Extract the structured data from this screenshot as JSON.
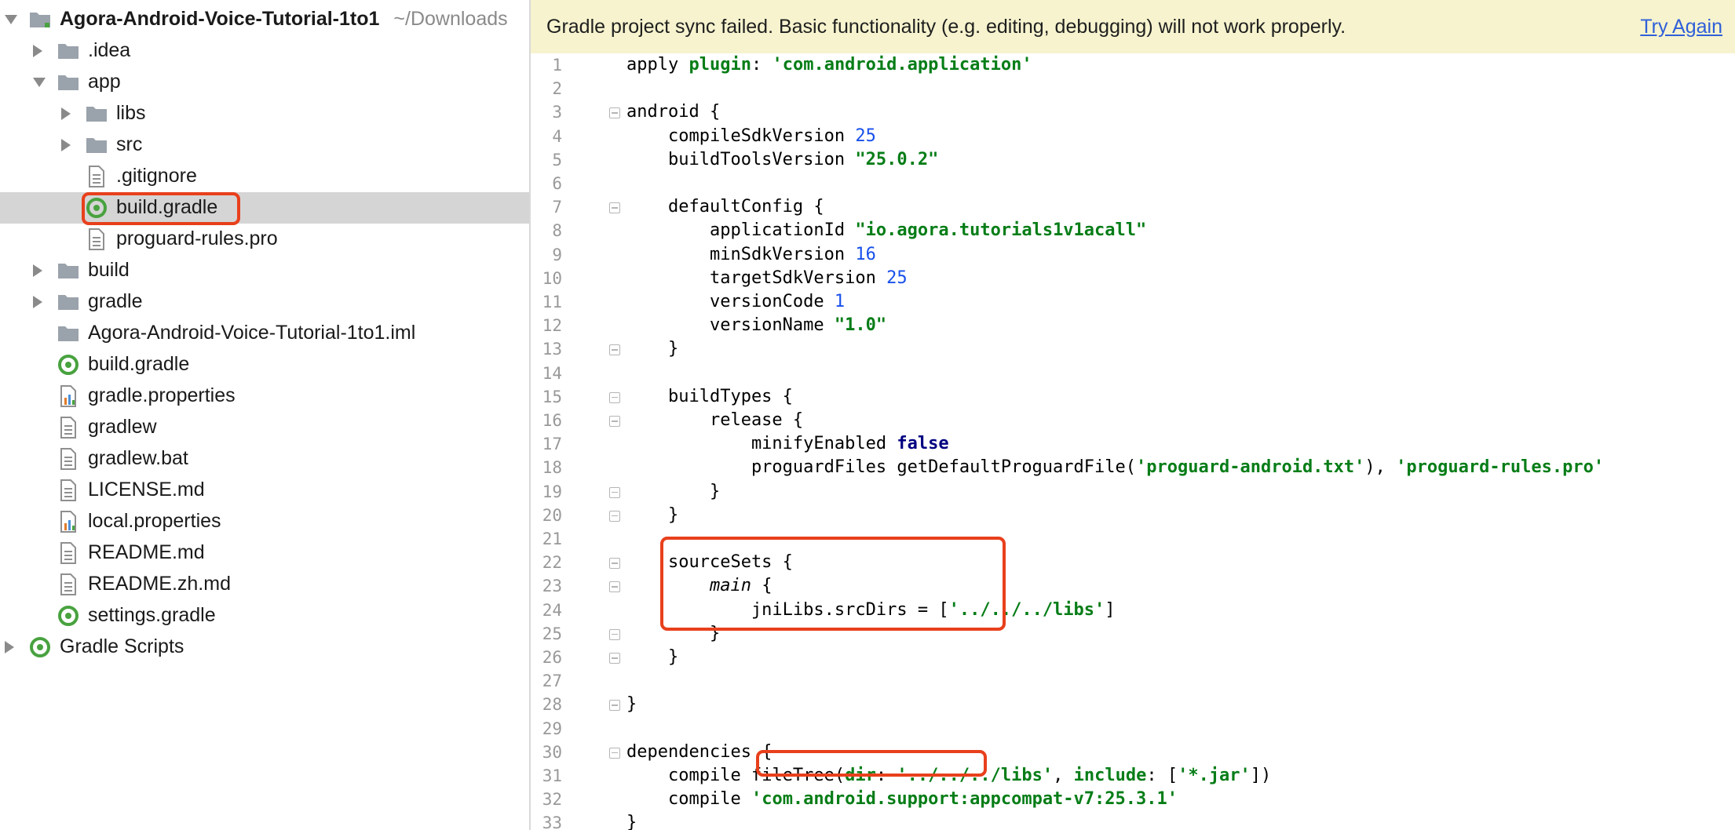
{
  "project_tree": {
    "root": {
      "name": "Agora-Android-Voice-Tutorial-1to1",
      "path": "~/Downloads"
    },
    "items": [
      {
        "label": ".idea"
      },
      {
        "label": "app"
      },
      {
        "label": "libs"
      },
      {
        "label": "src"
      },
      {
        "label": ".gitignore"
      },
      {
        "label": "build.gradle"
      },
      {
        "label": "proguard-rules.pro"
      },
      {
        "label": "build"
      },
      {
        "label": "gradle"
      },
      {
        "label": "Agora-Android-Voice-Tutorial-1to1.iml"
      },
      {
        "label": "build.gradle"
      },
      {
        "label": "gradle.properties"
      },
      {
        "label": "gradlew"
      },
      {
        "label": "gradlew.bat"
      },
      {
        "label": "LICENSE.md"
      },
      {
        "label": "local.properties"
      },
      {
        "label": "README.md"
      },
      {
        "label": "README.zh.md"
      },
      {
        "label": "settings.gradle"
      }
    ],
    "scripts_group": {
      "label": "Gradle Scripts"
    }
  },
  "banner": {
    "message": "Gradle project sync failed. Basic functionality (e.g. editing, debugging) will not work properly.",
    "action": "Try Again"
  },
  "editor": {
    "line_numbers": [
      "1",
      "2",
      "3",
      "4",
      "5",
      "6",
      "7",
      "8",
      "9",
      "10",
      "11",
      "12",
      "13",
      "14",
      "15",
      "16",
      "17",
      "18",
      "19",
      "20",
      "21",
      "22",
      "23",
      "24",
      "25",
      "26",
      "27",
      "28",
      "29",
      "30",
      "31",
      "32",
      "33"
    ],
    "lines": [
      [
        [
          "apply ",
          ""
        ],
        [
          "plugin",
          ""
        ],
        [
          ": ",
          ""
        ],
        [
          "'com.android.application'",
          "str"
        ]
      ],
      [],
      [
        [
          "android {",
          ""
        ]
      ],
      [
        [
          "    compileSdkVersion ",
          ""
        ],
        [
          "25",
          "num"
        ]
      ],
      [
        [
          "    buildToolsVersion ",
          ""
        ],
        [
          "\"25.0.2\"",
          "str"
        ]
      ],
      [],
      [
        [
          "    defaultConfig {",
          ""
        ]
      ],
      [
        [
          "        applicationId ",
          ""
        ],
        [
          "\"io.agora.tutorials1v1acall\"",
          "str"
        ]
      ],
      [
        [
          "        minSdkVersion ",
          ""
        ],
        [
          "16",
          "num"
        ]
      ],
      [
        [
          "        targetSdkVersion ",
          ""
        ],
        [
          "25",
          "num"
        ]
      ],
      [
        [
          "        versionCode ",
          ""
        ],
        [
          "1",
          "num"
        ]
      ],
      [
        [
          "        versionName ",
          ""
        ],
        [
          "\"1.0\"",
          "str"
        ]
      ],
      [
        [
          "    }",
          ""
        ]
      ],
      [],
      [
        [
          "    buildTypes {",
          ""
        ]
      ],
      [
        [
          "        release {",
          ""
        ]
      ],
      [
        [
          "            minifyEnabled ",
          ""
        ],
        [
          "false",
          "kw"
        ]
      ],
      [
        [
          "            proguardFiles getDefaultProguardFile(",
          ""
        ],
        [
          "'proguard-android.txt'",
          "str"
        ],
        [
          "), ",
          ""
        ],
        [
          "'proguard-rules.pro'",
          "str"
        ]
      ],
      [
        [
          "        }",
          ""
        ]
      ],
      [
        [
          "    }",
          ""
        ]
      ],
      [],
      [
        [
          "    sourceSets {",
          ""
        ]
      ],
      [
        [
          "        ",
          ""
        ],
        [
          "main",
          "it"
        ],
        [
          " {",
          ""
        ]
      ],
      [
        [
          "            jniLibs.srcDirs = [",
          ""
        ],
        [
          "'../../../libs'",
          "str"
        ],
        [
          "]",
          ""
        ]
      ],
      [
        [
          "        }",
          ""
        ]
      ],
      [
        [
          "    }",
          ""
        ]
      ],
      [],
      [
        [
          "}",
          ""
        ]
      ],
      [],
      [
        [
          "dependencies {",
          ""
        ]
      ],
      [
        [
          "    compile ",
          ""
        ],
        [
          "fileTree(",
          ""
        ],
        [
          "dir",
          ""
        ],
        [
          ": ",
          ""
        ],
        [
          "'../../../libs'",
          "str"
        ],
        [
          ", ",
          ""
        ],
        [
          "include",
          ""
        ],
        [
          ": [",
          ""
        ],
        [
          "'*.jar'",
          "str"
        ],
        [
          "])",
          ""
        ]
      ],
      [
        [
          "    compile ",
          ""
        ],
        [
          "'com.android.support:appcompat-v7:25.3.1'",
          "str"
        ]
      ],
      [
        [
          "}",
          ""
        ]
      ]
    ]
  },
  "colors": {
    "banner_bg": "#f6f3ce",
    "link": "#2f5fd9",
    "highlight": "#e8401c",
    "selection": "#d5d5d5",
    "string": "#067d17",
    "number": "#1750eb",
    "keyword": "#000080"
  }
}
